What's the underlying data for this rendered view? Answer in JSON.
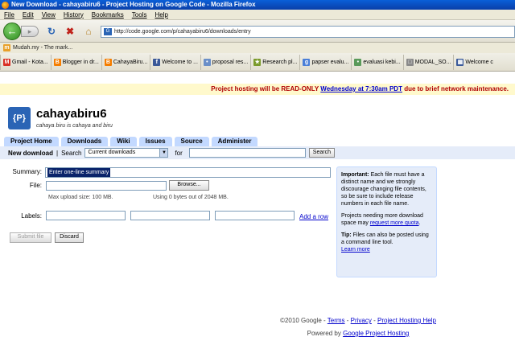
{
  "window": {
    "title": "New Download - cahayabiru6 - Project Hosting on Google Code - Mozilla Firefox"
  },
  "menubar": {
    "items": [
      "File",
      "Edit",
      "View",
      "History",
      "Bookmarks",
      "Tools",
      "Help"
    ]
  },
  "navbar": {
    "url": "http://code.google.com/p/cahayabiru6/downloads/entry"
  },
  "bookmarks_top": {
    "items": [
      "Mudah.my - The mark..."
    ]
  },
  "bookmarks": {
    "items": [
      {
        "label": "Gmail - Kota...",
        "icon": "gmail-icon",
        "color": "#d93025",
        "glyph": "M"
      },
      {
        "label": "Blogger in dr...",
        "icon": "blogger-icon",
        "color": "#f57d00",
        "glyph": "B"
      },
      {
        "label": "CahayaBiru...",
        "icon": "blogger-icon",
        "color": "#f57d00",
        "glyph": "B"
      },
      {
        "label": "Welcome to ...",
        "icon": "facebook-icon",
        "color": "#3b5998",
        "glyph": "f"
      },
      {
        "label": "proposal res...",
        "icon": "page-icon",
        "color": "#6a8fc8",
        "glyph": "•"
      },
      {
        "label": "Research pl...",
        "icon": "star-icon",
        "color": "#7a9a2a",
        "glyph": "★"
      },
      {
        "label": "papser evalu...",
        "icon": "google-icon",
        "color": "#4a7fd8",
        "glyph": "g"
      },
      {
        "label": "evaluasi kebi...",
        "icon": "page-icon",
        "color": "#5a9a5a",
        "glyph": "•"
      },
      {
        "label": "MODAL_SO...",
        "icon": "doc-icon",
        "color": "#8a8a8a",
        "glyph": "□"
      },
      {
        "label": "Welcome c",
        "icon": "grid-icon",
        "color": "#3a5a9a",
        "glyph": "▦"
      }
    ]
  },
  "notice": {
    "before": "Project hosting will be READ-ONLY",
    "link": "Wednesday at 7:30am PDT",
    "after": "due to brief network maintenance."
  },
  "project": {
    "logo_text": "{P}",
    "name": "cahayabiru6",
    "summary": "cahaya biru is cahaya and biru"
  },
  "tabs": [
    "Project Home",
    "Downloads",
    "Wiki",
    "Issues",
    "Source",
    "Administer"
  ],
  "subbar": {
    "new_download": "New download",
    "search_label": "Search",
    "select_value": "Current downloads",
    "for_label": "for",
    "search_button": "Search"
  },
  "form": {
    "summary_label": "Summary:",
    "summary_value": "Enter one-line summary",
    "file_label": "File:",
    "browse_button": "Browse...",
    "max_upload": "Max upload size: 100 MB.",
    "usage": "Using 0 bytes out of 2048 MB.",
    "labels_label": "Labels:",
    "add_row": "Add a row",
    "submit_button": "Submit file",
    "discard_button": "Discard"
  },
  "sidebox": {
    "important_head": "Important:",
    "important_text": "Each file must have a distinct name and we strongly discourage changing file contents, so be sure to include release numbers in each file name.",
    "quota_text": "Projects needing more download space may",
    "quota_link": "request more quota",
    "tip_head": "Tip:",
    "tip_text": "Files can also be posted using a command line tool.",
    "learn_more": "Learn more"
  },
  "footer": {
    "copyright": "©2010 Google -",
    "terms": "Terms",
    "privacy": "Privacy",
    "help": "Project Hosting Help",
    "powered_by": "Powered by",
    "powered_link": "Google Project Hosting"
  }
}
